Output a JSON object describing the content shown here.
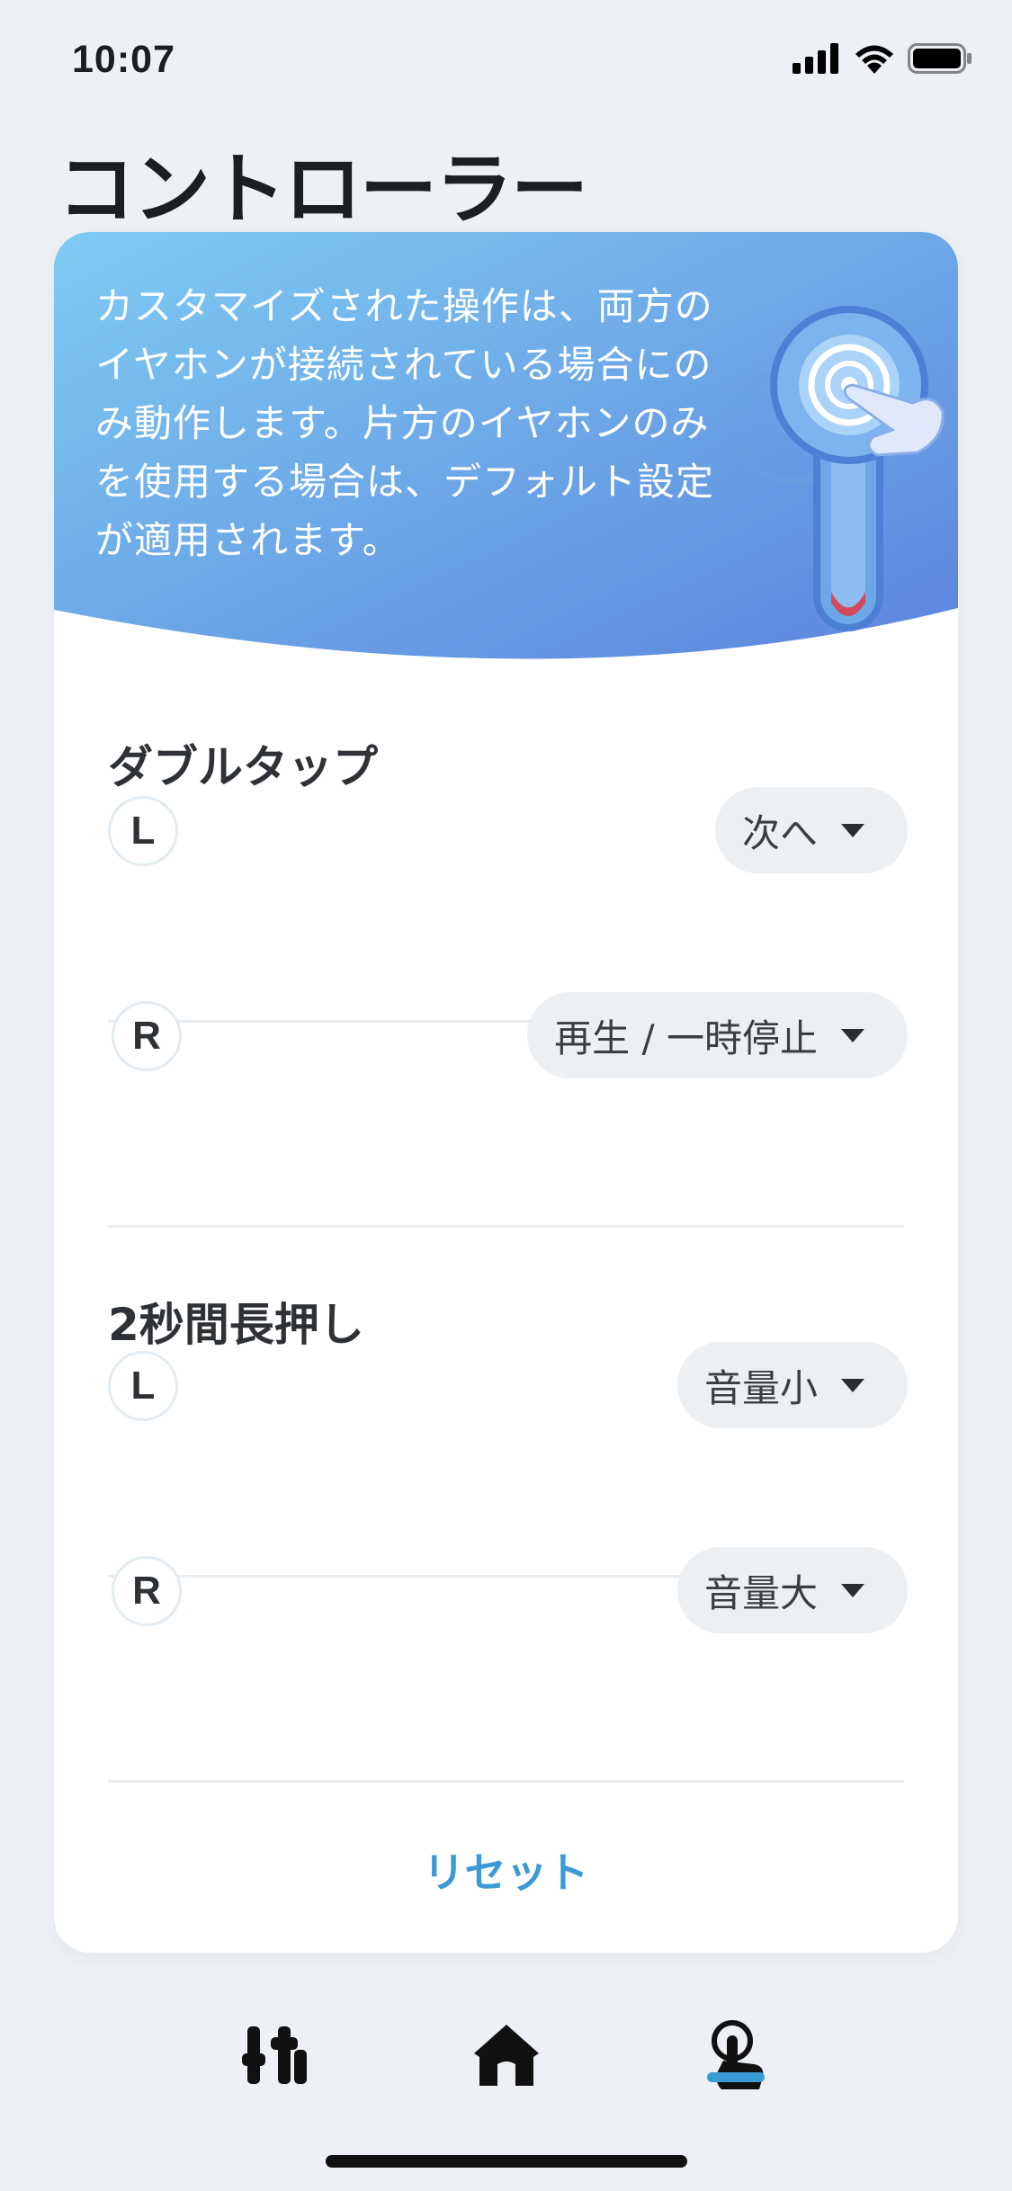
{
  "status_bar": {
    "time": "10:07"
  },
  "page": {
    "title": "コントローラー"
  },
  "hero": {
    "notice": "カスタマイズされた操作は、両方のイヤホンが接続されている場合にのみ動作します。片方のイヤホンのみを使用する場合は、デフォルト設定が適用されます。",
    "gradient_start": "#7ecbf3",
    "gradient_end": "#5c84dc"
  },
  "sections": [
    {
      "title": "ダブルタップ",
      "rows": [
        {
          "side": "L",
          "action": "次へ"
        },
        {
          "side": "R",
          "action": "再生 / 一時停止"
        }
      ]
    },
    {
      "title": "2秒間長押し",
      "rows": [
        {
          "side": "L",
          "action": "音量小"
        },
        {
          "side": "R",
          "action": "音量大"
        }
      ]
    }
  ],
  "reset_label": "リセット",
  "tabbar": {
    "tabs": [
      "equalizer-icon",
      "home-icon",
      "touch-control-icon"
    ],
    "active_tab": "touch-control-icon",
    "accent": "#3a9ad4"
  }
}
